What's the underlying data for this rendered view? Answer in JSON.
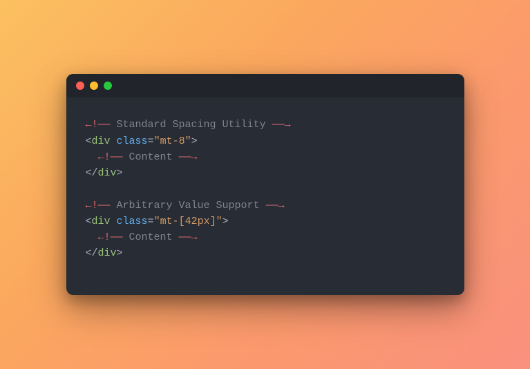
{
  "code": {
    "comment1": "Standard Spacing Utility",
    "tag1_open_name": "div",
    "tag1_attr": "class",
    "tag1_value": "mt-8",
    "content_comment1": "Content",
    "tag1_close_name": "div",
    "comment2": "Arbitrary Value Support",
    "tag2_open_name": "div",
    "tag2_attr": "class",
    "tag2_value": "mt-[42px]",
    "content_comment2": "Content",
    "tag2_close_name": "div",
    "delim_open": "←!――",
    "delim_close": "――→",
    "angle_open": "<",
    "angle_close": ">",
    "slash": "/",
    "eq": "=",
    "quote": "\""
  }
}
